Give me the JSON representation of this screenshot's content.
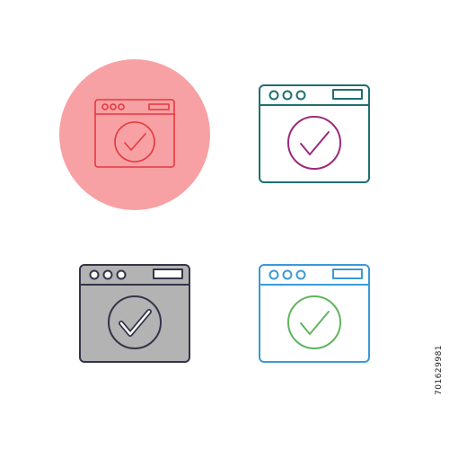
{
  "icons": [
    {
      "id": "icon-1",
      "variant": "flat-circle",
      "icon_name": "browser-check-icon",
      "colors": {
        "background": "#f7a1a4",
        "stroke": "#e8373f"
      }
    },
    {
      "id": "icon-2",
      "variant": "line-two-color",
      "icon_name": "browser-check-icon",
      "colors": {
        "window": "#1f6f6e",
        "check": "#9b2a7a"
      }
    },
    {
      "id": "icon-3",
      "variant": "filled-gray",
      "icon_name": "browser-check-icon",
      "colors": {
        "fill": "#b3b3b3",
        "stroke": "#34344a",
        "inner": "#ffffff"
      }
    },
    {
      "id": "icon-4",
      "variant": "line-blue-green",
      "icon_name": "browser-check-icon",
      "colors": {
        "window": "#3b99d6",
        "check": "#5fb55f"
      }
    }
  ],
  "stock_id": "701629981"
}
